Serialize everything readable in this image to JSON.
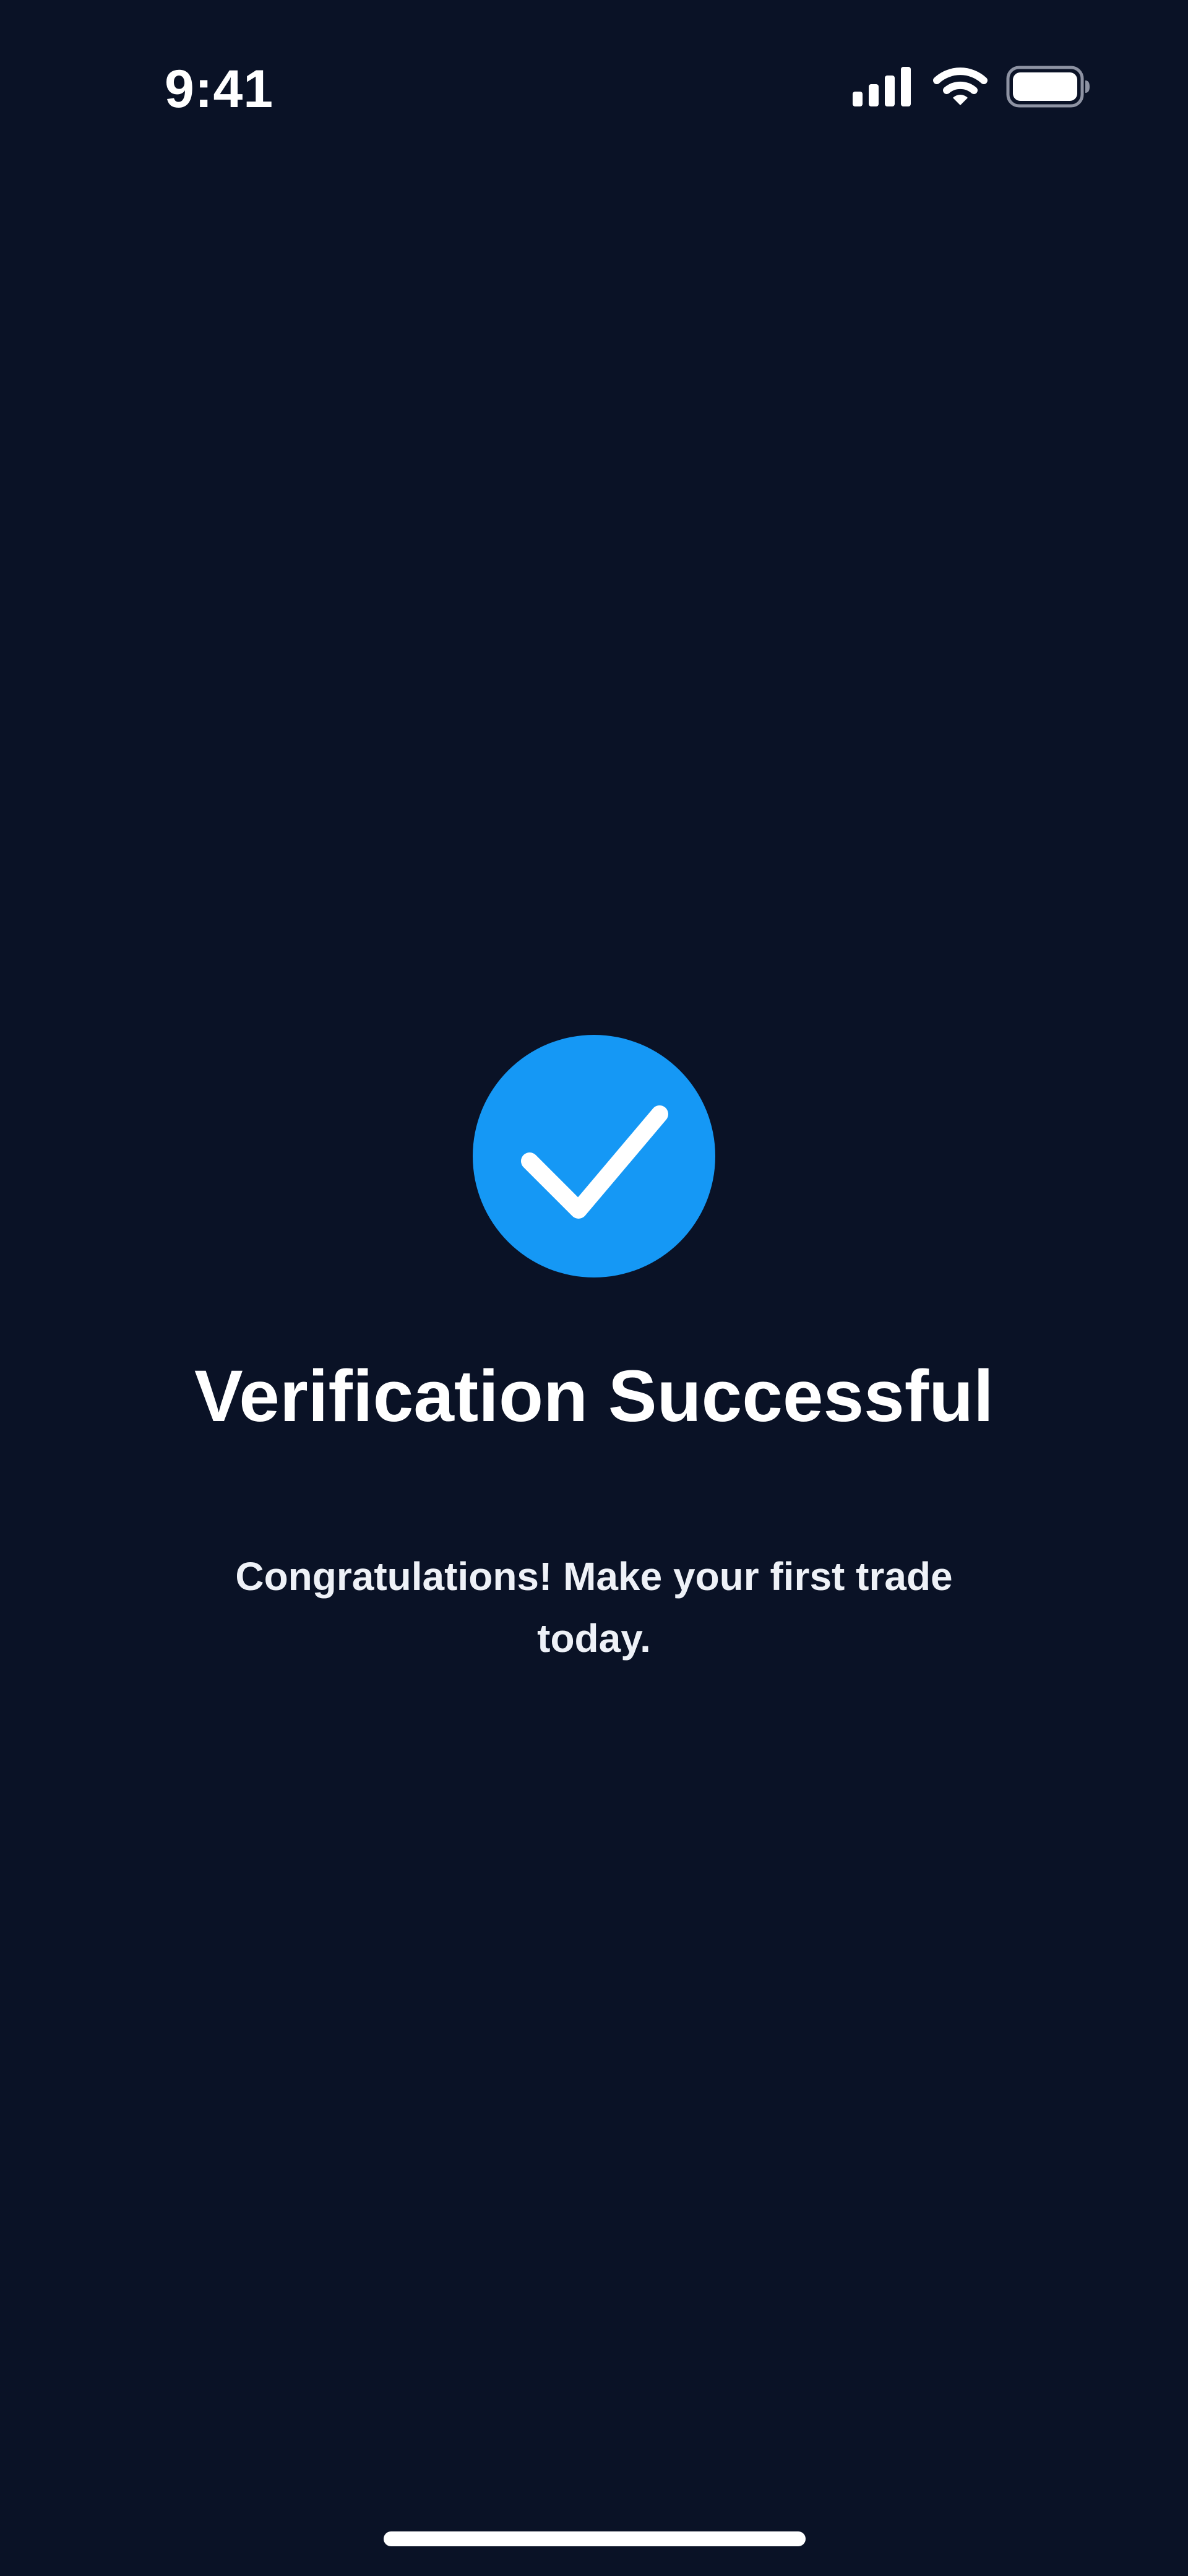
{
  "colors": {
    "background": "#0a1226",
    "accent": "#1598f5",
    "text": "#ffffff"
  },
  "status_bar": {
    "time": "9:41",
    "icons": [
      "cellular-signal-icon",
      "wifi-icon",
      "battery-icon"
    ]
  },
  "success": {
    "icon": "checkmark-icon",
    "title": "Verification Successful",
    "message": "Congratulations! Make your first trade today."
  }
}
